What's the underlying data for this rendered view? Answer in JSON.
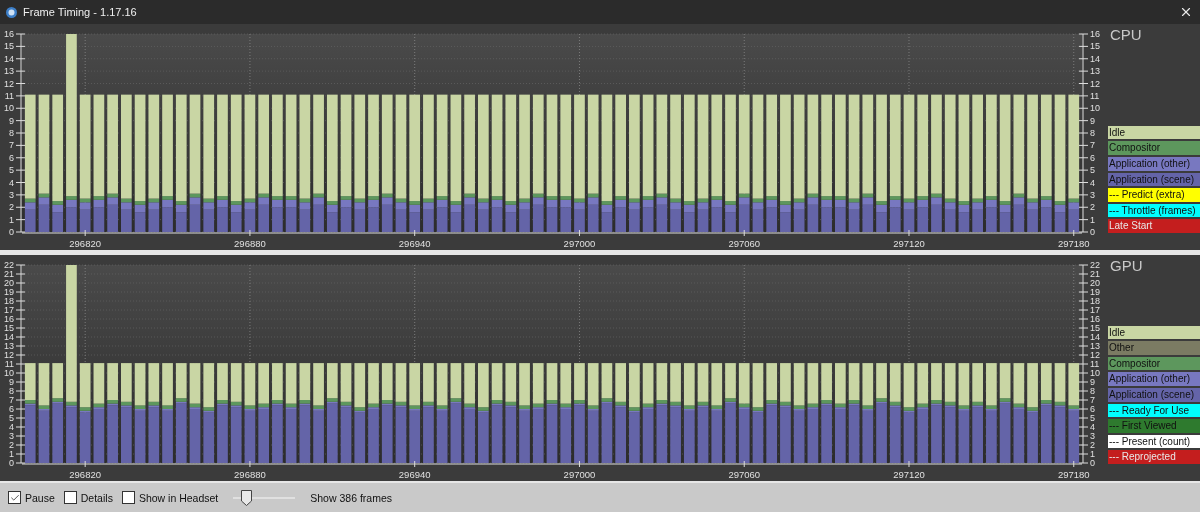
{
  "window": {
    "title": "Frame Timing - 1.17.16"
  },
  "charts": [
    {
      "chart_data": {
        "type": "bar",
        "title": "CPU",
        "stacked": true,
        "xlim": [
          296797,
          297183
        ],
        "ylim": [
          0,
          16
        ],
        "grid": true,
        "y2lim": [
          0,
          16
        ],
        "y2ticks": [
          0,
          1,
          2,
          3,
          4,
          5,
          6,
          7,
          8,
          9,
          10,
          11,
          12,
          13,
          14,
          15,
          16
        ],
        "xticks": [
          296820,
          296880,
          296940,
          297000,
          297060,
          297120,
          297180
        ],
        "yticks": [
          0,
          1,
          2,
          3,
          4,
          5,
          6,
          7,
          8,
          9,
          10,
          11,
          12,
          13,
          14,
          15,
          16
        ],
        "x": [
          296800,
          296805,
          296810,
          296815,
          296820,
          296825,
          296830,
          296835,
          296840,
          296845,
          296850,
          296855,
          296860,
          296865,
          296870,
          296875,
          296880,
          296885,
          296890,
          296895,
          296900,
          296905,
          296910,
          296915,
          296920,
          296925,
          296930,
          296935,
          296940,
          296945,
          296950,
          296955,
          296960,
          296965,
          296970,
          296975,
          296980,
          296985,
          296990,
          296995,
          297000,
          297005,
          297010,
          297015,
          297020,
          297025,
          297030,
          297035,
          297040,
          297045,
          297050,
          297055,
          297060,
          297065,
          297070,
          297075,
          297080,
          297085,
          297090,
          297095,
          297100,
          297105,
          297110,
          297115,
          297120,
          297125,
          297130,
          297135,
          297140,
          297145,
          297150,
          297155,
          297160,
          297165,
          297170,
          297175,
          297180
        ],
        "series": [
          {
            "name": "Application (scene)",
            "color": "#6464a8",
            "values": [
              1.8,
              2.2,
              1.6,
              2.0,
              1.8,
              2.0,
              2.2,
              1.8,
              1.6,
              1.8,
              2.0,
              1.6,
              2.2,
              1.8,
              2.0,
              1.6,
              1.8,
              2.2,
              2.0,
              2.0,
              1.8,
              2.2,
              1.6,
              2.0,
              1.8,
              2.0,
              2.2,
              1.8,
              1.6,
              1.8,
              2.0,
              1.6,
              2.2,
              1.8,
              2.0,
              1.6,
              1.8,
              2.2,
              2.0,
              2.0,
              1.8,
              2.2,
              1.6,
              2.0,
              1.8,
              2.0,
              2.2,
              1.8,
              1.6,
              1.8,
              2.0,
              1.6,
              2.2,
              1.8,
              2.0,
              1.6,
              1.8,
              2.2,
              2.0,
              2.0,
              1.8,
              2.2,
              1.6,
              2.0,
              1.8,
              2.0,
              2.2,
              1.8,
              1.6,
              1.8,
              2.0,
              1.6,
              2.2,
              1.8,
              2.0,
              1.6,
              1.8
            ]
          },
          {
            "name": "Application (other)",
            "color": "#7878c0",
            "values": [
              0.6,
              0.6,
              0.6,
              0.6,
              0.6,
              0.6,
              0.6,
              0.6,
              0.6,
              0.6,
              0.6,
              0.6,
              0.6,
              0.6,
              0.6,
              0.6,
              0.6,
              0.6,
              0.6,
              0.6,
              0.6,
              0.6,
              0.6,
              0.6,
              0.6,
              0.6,
              0.6,
              0.6,
              0.6,
              0.6,
              0.6,
              0.6,
              0.6,
              0.6,
              0.6,
              0.6,
              0.6,
              0.6,
              0.6,
              0.6,
              0.6,
              0.6,
              0.6,
              0.6,
              0.6,
              0.6,
              0.6,
              0.6,
              0.6,
              0.6,
              0.6,
              0.6,
              0.6,
              0.6,
              0.6,
              0.6,
              0.6,
              0.6,
              0.6,
              0.6,
              0.6,
              0.6,
              0.6,
              0.6,
              0.6,
              0.6,
              0.6,
              0.6,
              0.6,
              0.6,
              0.6,
              0.6,
              0.6,
              0.6,
              0.6,
              0.6,
              0.6
            ]
          },
          {
            "name": "Compositor",
            "color": "#5d975d",
            "values": [
              0.3,
              0.3,
              0.3,
              0.3,
              0.3,
              0.3,
              0.3,
              0.3,
              0.3,
              0.3,
              0.3,
              0.3,
              0.3,
              0.3,
              0.3,
              0.3,
              0.3,
              0.3,
              0.3,
              0.3,
              0.3,
              0.3,
              0.3,
              0.3,
              0.3,
              0.3,
              0.3,
              0.3,
              0.3,
              0.3,
              0.3,
              0.3,
              0.3,
              0.3,
              0.3,
              0.3,
              0.3,
              0.3,
              0.3,
              0.3,
              0.3,
              0.3,
              0.3,
              0.3,
              0.3,
              0.3,
              0.3,
              0.3,
              0.3,
              0.3,
              0.3,
              0.3,
              0.3,
              0.3,
              0.3,
              0.3,
              0.3,
              0.3,
              0.3,
              0.3,
              0.3,
              0.3,
              0.3,
              0.3,
              0.3,
              0.3,
              0.3,
              0.3,
              0.3,
              0.3,
              0.3,
              0.3,
              0.3,
              0.3,
              0.3,
              0.3,
              0.3
            ]
          },
          {
            "name": "Idle",
            "color": "#c9d6a4",
            "values": [
              8.4,
              8.0,
              8.6,
              13.1,
              8.4,
              8.2,
              8.0,
              8.4,
              8.6,
              8.4,
              8.2,
              8.6,
              8.0,
              8.4,
              8.2,
              8.6,
              8.4,
              8.0,
              8.2,
              8.2,
              8.4,
              8.0,
              8.6,
              8.2,
              8.4,
              8.2,
              8.0,
              8.4,
              8.6,
              8.4,
              8.2,
              8.6,
              8.0,
              8.4,
              8.2,
              8.6,
              8.4,
              8.0,
              8.2,
              8.2,
              8.4,
              8.0,
              8.6,
              8.2,
              8.4,
              8.2,
              8.0,
              8.4,
              8.6,
              8.4,
              8.2,
              8.6,
              8.0,
              8.4,
              8.2,
              8.6,
              8.4,
              8.0,
              8.2,
              8.2,
              8.4,
              8.0,
              8.6,
              8.2,
              8.4,
              8.2,
              8.0,
              8.4,
              8.6,
              8.4,
              8.2,
              8.6,
              8.0,
              8.4,
              8.2,
              8.6,
              8.4
            ]
          }
        ]
      },
      "legend": [
        {
          "label": "--- Predict (extra)",
          "color": "#ffff00"
        },
        {
          "label": "--- Throttle (frames)",
          "color": "#00ffff"
        },
        {
          "label": "Late Start",
          "color": "#c41e1e"
        }
      ]
    },
    {
      "chart_data": {
        "type": "bar",
        "title": "GPU",
        "stacked": true,
        "xlim": [
          296797,
          297183
        ],
        "ylim": [
          0,
          22
        ],
        "grid": true,
        "y2lim": [
          0,
          22
        ],
        "y2ticks": [
          0,
          1,
          2,
          3,
          4,
          5,
          6,
          7,
          8,
          9,
          10,
          11,
          12,
          13,
          14,
          15,
          16,
          17,
          18,
          19,
          20,
          21,
          22
        ],
        "xticks": [
          296820,
          296880,
          296940,
          297000,
          297060,
          297120,
          297180
        ],
        "yticks": [
          0,
          1,
          2,
          3,
          4,
          5,
          6,
          7,
          8,
          9,
          10,
          11,
          12,
          13,
          14,
          15,
          16,
          17,
          18,
          19,
          20,
          21,
          22
        ],
        "x": [
          296800,
          296805,
          296810,
          296815,
          296820,
          296825,
          296830,
          296835,
          296840,
          296845,
          296850,
          296855,
          296860,
          296865,
          296870,
          296875,
          296880,
          296885,
          296890,
          296895,
          296900,
          296905,
          296910,
          296915,
          296920,
          296925,
          296930,
          296935,
          296940,
          296945,
          296950,
          296955,
          296960,
          296965,
          296970,
          296975,
          296980,
          296985,
          296990,
          296995,
          297000,
          297005,
          297010,
          297015,
          297020,
          297025,
          297030,
          297035,
          297040,
          297045,
          297050,
          297055,
          297060,
          297065,
          297070,
          297075,
          297080,
          297085,
          297090,
          297095,
          297100,
          297105,
          297110,
          297115,
          297120,
          297125,
          297130,
          297135,
          297140,
          297145,
          297150,
          297155,
          297160,
          297165,
          297170,
          297175,
          297180
        ],
        "series": [
          {
            "name": "Application (scene)",
            "color": "#6464a8",
            "values": [
              6.4,
              5.8,
              6.6,
              6.2,
              5.6,
              6.0,
              6.4,
              6.2,
              5.8,
              6.2,
              5.8,
              6.6,
              6.0,
              5.6,
              6.4,
              6.2,
              5.8,
              6.0,
              6.4,
              6.0,
              6.4,
              5.8,
              6.6,
              6.2,
              5.6,
              6.0,
              6.4,
              6.2,
              5.8,
              6.2,
              5.8,
              6.6,
              6.0,
              5.6,
              6.4,
              6.2,
              5.8,
              6.0,
              6.4,
              6.0,
              6.4,
              5.8,
              6.6,
              6.2,
              5.6,
              6.0,
              6.4,
              6.2,
              5.8,
              6.2,
              5.8,
              6.6,
              6.0,
              5.6,
              6.4,
              6.2,
              5.8,
              6.0,
              6.4,
              6.0,
              6.4,
              5.8,
              6.6,
              6.2,
              5.6,
              6.0,
              6.4,
              6.2,
              5.8,
              6.2,
              5.8,
              6.6,
              6.0,
              5.6,
              6.4,
              6.2,
              5.8
            ]
          },
          {
            "name": "Application (other)",
            "color": "#7878c0",
            "values": [
              0.2,
              0.2,
              0.2,
              0.2,
              0.2,
              0.2,
              0.2,
              0.2,
              0.2,
              0.2,
              0.2,
              0.2,
              0.2,
              0.2,
              0.2,
              0.2,
              0.2,
              0.2,
              0.2,
              0.2,
              0.2,
              0.2,
              0.2,
              0.2,
              0.2,
              0.2,
              0.2,
              0.2,
              0.2,
              0.2,
              0.2,
              0.2,
              0.2,
              0.2,
              0.2,
              0.2,
              0.2,
              0.2,
              0.2,
              0.2,
              0.2,
              0.2,
              0.2,
              0.2,
              0.2,
              0.2,
              0.2,
              0.2,
              0.2,
              0.2,
              0.2,
              0.2,
              0.2,
              0.2,
              0.2,
              0.2,
              0.2,
              0.2,
              0.2,
              0.2,
              0.2,
              0.2,
              0.2,
              0.2,
              0.2,
              0.2,
              0.2,
              0.2,
              0.2,
              0.2,
              0.2,
              0.2,
              0.2,
              0.2,
              0.2,
              0.2,
              0.2
            ]
          },
          {
            "name": "Compositor",
            "color": "#5d975d",
            "values": [
              0.4,
              0.4,
              0.4,
              0.4,
              0.4,
              0.4,
              0.4,
              0.4,
              0.4,
              0.4,
              0.4,
              0.4,
              0.4,
              0.4,
              0.4,
              0.4,
              0.4,
              0.4,
              0.4,
              0.4,
              0.4,
              0.4,
              0.4,
              0.4,
              0.4,
              0.4,
              0.4,
              0.4,
              0.4,
              0.4,
              0.4,
              0.4,
              0.4,
              0.4,
              0.4,
              0.4,
              0.4,
              0.4,
              0.4,
              0.4,
              0.4,
              0.4,
              0.4,
              0.4,
              0.4,
              0.4,
              0.4,
              0.4,
              0.4,
              0.4,
              0.4,
              0.4,
              0.4,
              0.4,
              0.4,
              0.4,
              0.4,
              0.4,
              0.4,
              0.4,
              0.4,
              0.4,
              0.4,
              0.4,
              0.4,
              0.4,
              0.4,
              0.4,
              0.4,
              0.4,
              0.4,
              0.4,
              0.4,
              0.4,
              0.4,
              0.4,
              0.4
            ]
          },
          {
            "name": "Other",
            "color": "#7b7b63",
            "values": [
              0,
              0,
              0,
              0,
              0,
              0,
              0,
              0,
              0,
              0,
              0,
              0,
              0,
              0,
              0,
              0,
              0,
              0,
              0,
              0,
              0,
              0,
              0,
              0,
              0,
              0,
              0,
              0,
              0,
              0,
              0,
              0,
              0,
              0,
              0,
              0,
              0,
              0,
              0,
              0,
              0,
              0,
              0,
              0,
              0,
              0,
              0,
              0,
              0,
              0,
              0,
              0,
              0,
              0,
              0,
              0,
              0,
              0,
              0,
              0,
              0,
              0,
              0,
              0,
              0,
              0,
              0,
              0,
              0,
              0,
              0,
              0,
              0,
              0,
              0,
              0,
              0
            ]
          },
          {
            "name": "Idle",
            "color": "#c9d6a4",
            "values": [
              4.1,
              4.7,
              3.9,
              15.2,
              4.9,
              4.5,
              4.1,
              4.3,
              4.7,
              4.3,
              4.7,
              3.9,
              4.5,
              4.9,
              4.1,
              4.3,
              4.7,
              4.5,
              4.1,
              4.5,
              4.1,
              4.7,
              3.9,
              4.3,
              4.9,
              4.5,
              4.1,
              4.3,
              4.7,
              4.3,
              4.7,
              3.9,
              4.5,
              4.9,
              4.1,
              4.3,
              4.7,
              4.5,
              4.1,
              4.5,
              4.1,
              4.7,
              3.9,
              4.3,
              4.9,
              4.5,
              4.1,
              4.3,
              4.7,
              4.3,
              4.7,
              3.9,
              4.5,
              4.9,
              4.1,
              4.3,
              4.7,
              4.5,
              4.1,
              4.5,
              4.1,
              4.7,
              3.9,
              4.3,
              4.9,
              4.5,
              4.1,
              4.3,
              4.7,
              4.3,
              4.7,
              3.9,
              4.5,
              4.9,
              4.1,
              4.3,
              4.7
            ]
          }
        ]
      },
      "legend": [
        {
          "label": "--- Ready For Use",
          "color": "#00ffff"
        },
        {
          "label": "--- First Viewed",
          "color": "#2e7a2e"
        },
        {
          "label": "--- Present (count)",
          "color": "#ffffff"
        },
        {
          "label": "--- Reprojected",
          "color": "#c41e1e"
        }
      ]
    }
  ],
  "controls": [
    {
      "kind": "checkbox",
      "label": "Pause",
      "checked": true
    },
    {
      "kind": "checkbox",
      "label": "Details",
      "checked": false
    },
    {
      "kind": "checkbox",
      "label": "Show in Headset",
      "checked": false
    },
    {
      "kind": "slider",
      "level": 0.2
    },
    {
      "kind": "text",
      "label": "Show 386 frames"
    }
  ]
}
